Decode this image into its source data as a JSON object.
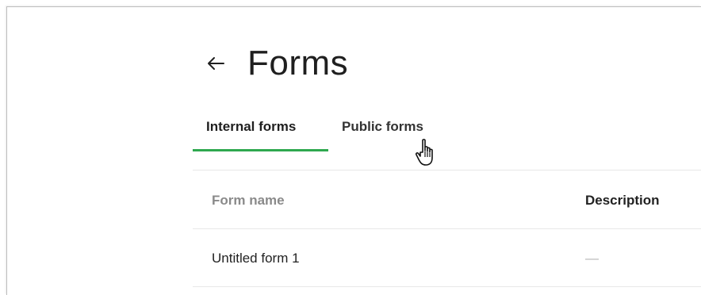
{
  "header": {
    "title": "Forms",
    "back_icon": "arrow-left-icon"
  },
  "tabs": [
    {
      "label": "Internal forms",
      "active": true
    },
    {
      "label": "Public forms",
      "active": false
    }
  ],
  "table": {
    "columns": [
      "Form name",
      "Description"
    ],
    "rows": [
      {
        "name": "Untitled form 1",
        "description": "—"
      }
    ]
  },
  "colors": {
    "active_tab_underline": "#2fa84f"
  },
  "cursor": "hand-pointer-icon"
}
